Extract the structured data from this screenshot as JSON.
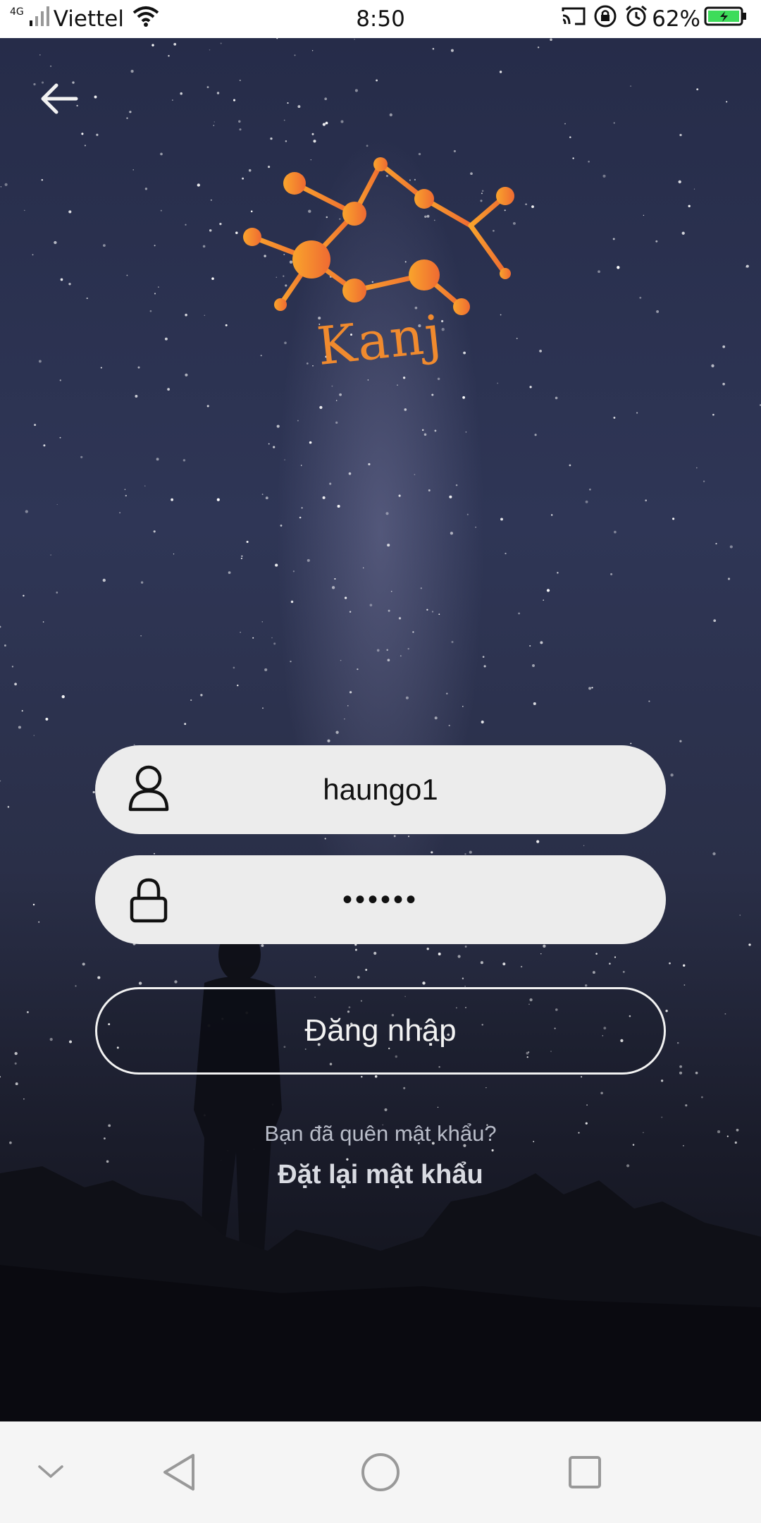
{
  "status_bar": {
    "network_type": "4G",
    "carrier": "Viettel",
    "time": "8:50",
    "battery_percent": "62%",
    "icons": [
      "signal-icon",
      "wifi-icon",
      "cast-icon",
      "rotation-lock-icon",
      "alarm-icon",
      "battery-charging-icon"
    ]
  },
  "header": {
    "back_icon": "arrow-left-icon"
  },
  "logo": {
    "text": "Kanj",
    "accent_color": "#f08a2e"
  },
  "login_form": {
    "username": {
      "value": "haungo1",
      "icon": "user-icon"
    },
    "password": {
      "value": "••••••",
      "icon": "lock-icon"
    },
    "submit_label": "Đăng nhập",
    "forgot_text": "Bạn đã quên mật khẩu?",
    "reset_link": "Đặt lại mật khẩu"
  },
  "nav_bar": {
    "icons": [
      "chevron-down-icon",
      "back-triangle-icon",
      "home-circle-icon",
      "recents-square-icon"
    ]
  }
}
